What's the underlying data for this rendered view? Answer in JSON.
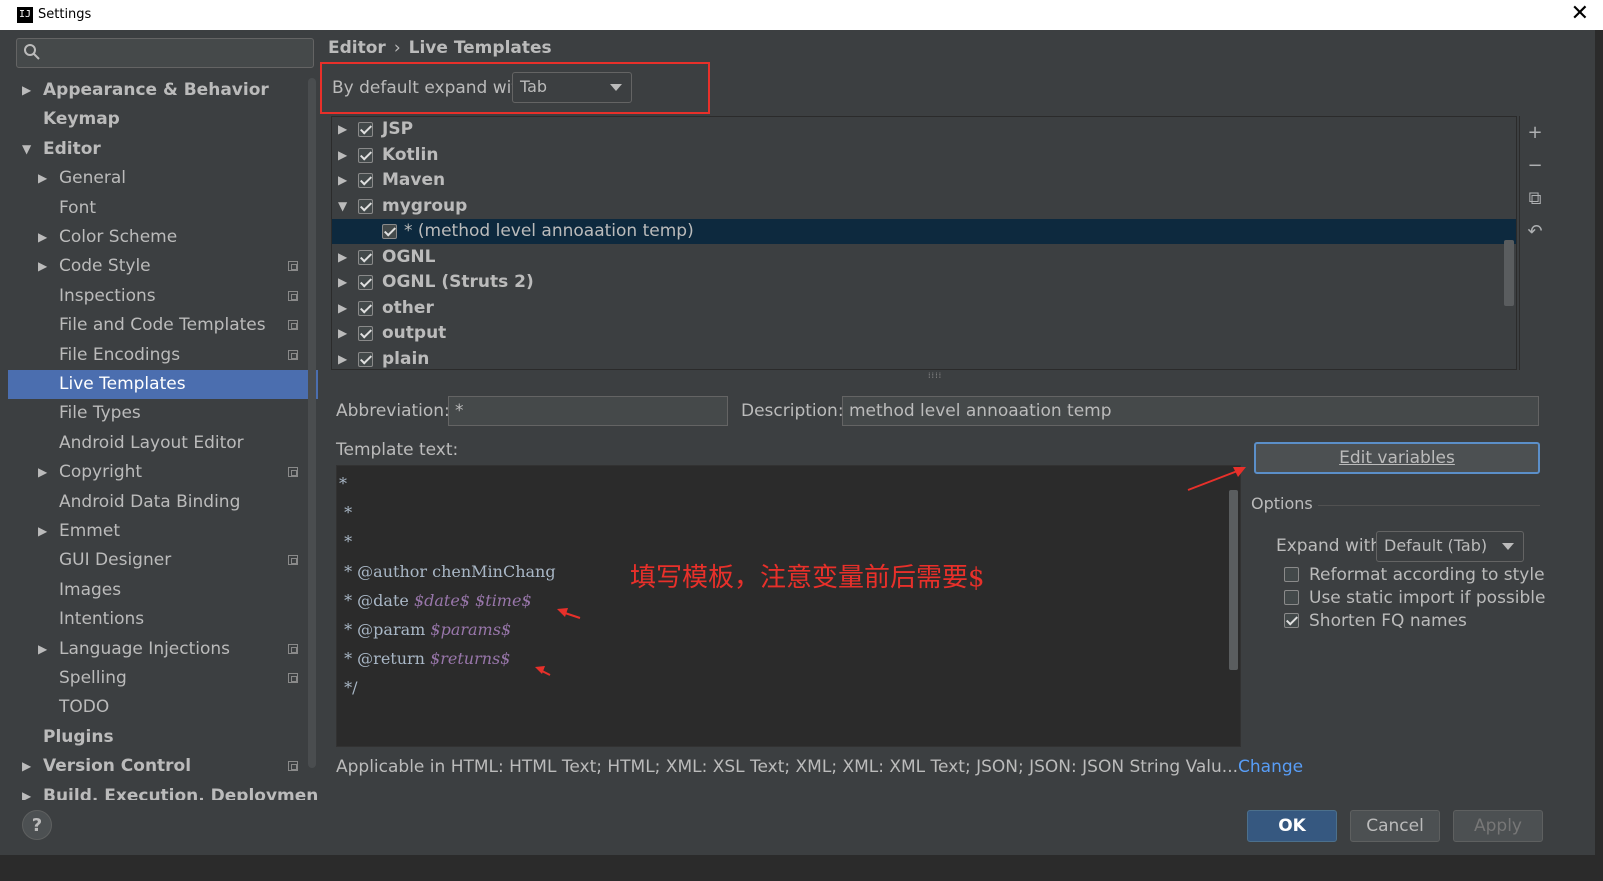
{
  "window": {
    "title": "Settings",
    "app_icon": "IJ",
    "close_glyph": "✕"
  },
  "search": {
    "icon": "search-icon",
    "value": ""
  },
  "sidebar": {
    "items": [
      {
        "label": "Appearance & Behavior",
        "level": 0,
        "arrow": "▶",
        "bold": true
      },
      {
        "label": "Keymap",
        "level": 0,
        "arrow": "",
        "bold": true
      },
      {
        "label": "Editor",
        "level": 0,
        "arrow": "▼",
        "bold": true
      },
      {
        "label": "General",
        "level": 1,
        "arrow": "▶"
      },
      {
        "label": "Font",
        "level": 1,
        "arrow": ""
      },
      {
        "label": "Color Scheme",
        "level": 1,
        "arrow": "▶"
      },
      {
        "label": "Code Style",
        "level": 1,
        "arrow": "▶",
        "cfg": true
      },
      {
        "label": "Inspections",
        "level": 1,
        "arrow": "",
        "cfg": true
      },
      {
        "label": "File and Code Templates",
        "level": 1,
        "arrow": "",
        "cfg": true
      },
      {
        "label": "File Encodings",
        "level": 1,
        "arrow": "",
        "cfg": true
      },
      {
        "label": "Live Templates",
        "level": 1,
        "arrow": "",
        "selected": true
      },
      {
        "label": "File Types",
        "level": 1,
        "arrow": ""
      },
      {
        "label": "Android Layout Editor",
        "level": 1,
        "arrow": ""
      },
      {
        "label": "Copyright",
        "level": 1,
        "arrow": "▶",
        "cfg": true
      },
      {
        "label": "Android Data Binding",
        "level": 1,
        "arrow": ""
      },
      {
        "label": "Emmet",
        "level": 1,
        "arrow": "▶"
      },
      {
        "label": "GUI Designer",
        "level": 1,
        "arrow": "",
        "cfg": true
      },
      {
        "label": "Images",
        "level": 1,
        "arrow": ""
      },
      {
        "label": "Intentions",
        "level": 1,
        "arrow": ""
      },
      {
        "label": "Language Injections",
        "level": 1,
        "arrow": "▶",
        "cfg": true
      },
      {
        "label": "Spelling",
        "level": 1,
        "arrow": "",
        "cfg": true
      },
      {
        "label": "TODO",
        "level": 1,
        "arrow": ""
      },
      {
        "label": "Plugins",
        "level": 0,
        "arrow": "",
        "bold": true
      },
      {
        "label": "Version Control",
        "level": 0,
        "arrow": "▶",
        "bold": true,
        "cfg": true
      },
      {
        "label": "Build, Execution, Deployment",
        "level": 0,
        "arrow": "▶",
        "bold": true
      }
    ]
  },
  "breadcrumb": {
    "parent": "Editor",
    "separator": "›",
    "current": "Live Templates"
  },
  "expand": {
    "label": "By default expand with",
    "value": "Tab"
  },
  "template_groups": [
    {
      "label": "JSP",
      "expanded": false,
      "checked": true
    },
    {
      "label": "Kotlin",
      "expanded": false,
      "checked": true
    },
    {
      "label": "Maven",
      "expanded": false,
      "checked": true
    },
    {
      "label": "mygroup",
      "expanded": true,
      "checked": true
    },
    {
      "label": "* (method level annoaation temp)",
      "child": true,
      "checked": true,
      "selected": true
    },
    {
      "label": "OGNL",
      "expanded": false,
      "checked": true
    },
    {
      "label": "OGNL (Struts 2)",
      "expanded": false,
      "checked": true
    },
    {
      "label": "other",
      "expanded": false,
      "checked": true
    },
    {
      "label": "output",
      "expanded": false,
      "checked": true
    },
    {
      "label": "plain",
      "expanded": false,
      "checked": true
    }
  ],
  "list_tools": {
    "add": "+",
    "remove": "−",
    "copy": "⧉",
    "revert": "↶"
  },
  "abbreviation": {
    "label": "Abbreviation:",
    "value": "*"
  },
  "description": {
    "label": "Description:",
    "value": "method level annoaation temp"
  },
  "template_text": {
    "label": "Template text:",
    "lines": [
      [
        {
          "t": "*"
        }
      ],
      [
        {
          "t": " *"
        }
      ],
      [
        {
          "t": " *"
        }
      ],
      [
        {
          "t": " * @author chenMinChang"
        }
      ],
      [
        {
          "t": " * @date "
        },
        {
          "t": "$date$",
          "var": true
        },
        {
          "t": " "
        },
        {
          "t": "$time$",
          "var": true
        }
      ],
      [
        {
          "t": " * @param "
        },
        {
          "t": "$params$",
          "var": true
        }
      ],
      [
        {
          "t": " * @return "
        },
        {
          "t": "$returns$",
          "var": true
        }
      ],
      [
        {
          "t": " */"
        }
      ]
    ]
  },
  "annotation": {
    "text": "填写模板，注意变量前后需要$",
    "color": "#e8302a"
  },
  "edit_variables": {
    "label": "Edit variables"
  },
  "options": {
    "header": "Options",
    "expand_with_label": "Expand with",
    "expand_with_value": "Default (Tab)",
    "reformat": {
      "label": "Reformat according to style",
      "checked": false
    },
    "static_import": {
      "label": "Use static import if possible",
      "checked": false
    },
    "shorten_fq": {
      "label": "Shorten FQ names",
      "checked": true
    }
  },
  "applicable": {
    "text": "Applicable in HTML: HTML Text; HTML; XML: XSL Text; XML; XML: XML Text; JSON; JSON: JSON String Valu...",
    "link": "Change"
  },
  "footer": {
    "help": "?",
    "ok": "OK",
    "cancel": "Cancel",
    "apply": "Apply"
  },
  "colors": {
    "accent": "#4b6eaf",
    "annotation": "#e8302a",
    "link": "#589df6",
    "selection": "#0d293e"
  }
}
